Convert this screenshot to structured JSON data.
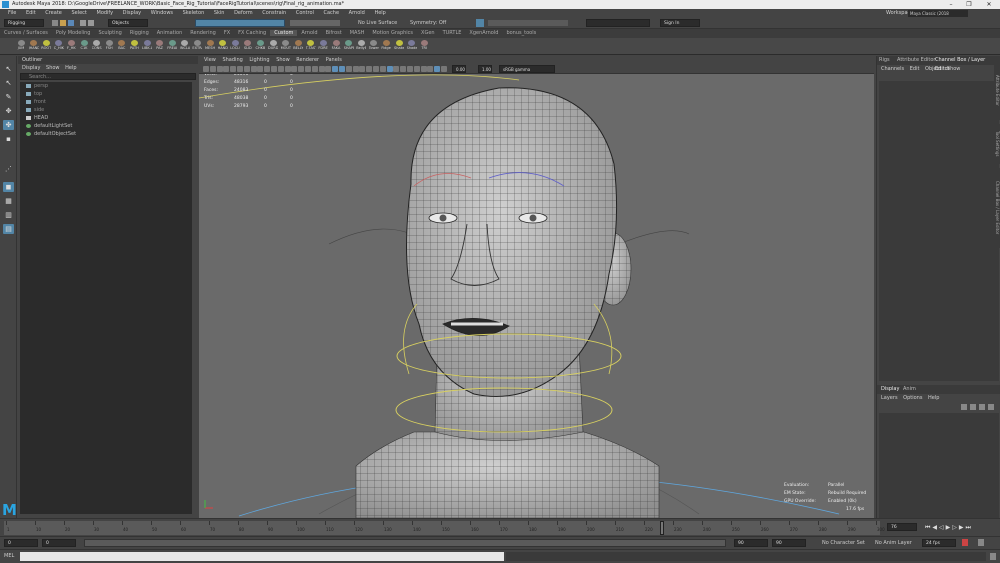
{
  "window": {
    "title": "Autodesk Maya 2018: D:\\GoogleDrive\\FREELANCE_WORK\\Basic_Face_Rig_Tutorial\\FaceRigTutorial\\scenes\\rig\\Final_rig_animation.ma*",
    "controls": [
      "–",
      "❐",
      "✕"
    ]
  },
  "menubar": [
    "File",
    "Edit",
    "Create",
    "Select",
    "Modify",
    "Display",
    "Windows",
    "Skeleton",
    "Skin",
    "Deform",
    "Constrain",
    "Control",
    "Cache",
    "Arnold",
    "Help"
  ],
  "workspace": {
    "label": "Workspace:",
    "value": "Maya Classic (2018 TUTORIAL)"
  },
  "statusline": {
    "mode": "Rigging",
    "objects": "Objects",
    "live_surface": "No Live Surface",
    "symmetry": "Symmetry: Off",
    "sign_in": "Sign In"
  },
  "shelf_tabs": [
    "Curves / Surfaces",
    "Poly Modeling",
    "Sculpting",
    "Rigging",
    "Animation",
    "Rendering",
    "FX",
    "FX Caching",
    "Custom",
    "Arnold",
    "Bifrost",
    "MASH",
    "Motion Graphics",
    "XGen",
    "TURTLE",
    "XgenArnold",
    "bonus_tools"
  ],
  "active_shelf_tab": 8,
  "shelf_buttons": [
    "JUM",
    "JHAND",
    "ROOT",
    "C_HIK",
    "F_HK",
    "C1K",
    "CONS",
    "FSH",
    "BAC",
    "PATH",
    "LIBK.LI",
    "PAZ",
    "FREAK",
    "INCLAB",
    "EXTRACT",
    "MESH",
    "HAND",
    "LOCLS",
    "SLID",
    "CHKB",
    "DURDAC",
    "MOUTH",
    "BELLY",
    "T.TASTE",
    "FDRET",
    "FAKA",
    "SHAPE",
    "BellyB",
    "Tower",
    "Fidget",
    "Shake",
    "Shader",
    "TRI"
  ],
  "outliner": {
    "title": "Outliner",
    "menu": [
      "Display",
      "Show",
      "Help"
    ],
    "search_placeholder": "Search...",
    "items": [
      "persp",
      "top",
      "front",
      "side",
      "HEAD",
      "defaultLightSet",
      "defaultObjectSet"
    ]
  },
  "viewport": {
    "menu": [
      "View",
      "Shading",
      "Lighting",
      "Show",
      "Renderer",
      "Panels"
    ],
    "gamma": "sRGB gamma",
    "exposure": "0.00",
    "gamma_value": "1.00",
    "hud_stats": [
      {
        "label": "Verts:",
        "v1": "24091",
        "v2": "0",
        "v3": "0"
      },
      {
        "label": "Edges:",
        "v1": "48316",
        "v2": "0",
        "v3": "0"
      },
      {
        "label": "Faces:",
        "v1": "24083",
        "v2": "0",
        "v3": "0"
      },
      {
        "label": "Tris:",
        "v1": "48038",
        "v2": "0",
        "v3": "0"
      },
      {
        "label": "UVs:",
        "v1": "28793",
        "v2": "0",
        "v3": "0"
      }
    ],
    "hud_eval": [
      {
        "label": "Evaluation:",
        "value": "Parallel"
      },
      {
        "label": "EM State:",
        "value": "Rebuild Required"
      },
      {
        "label": "GPU Override:",
        "value": "Enabled (0k)"
      }
    ],
    "fps": "17.6 fps"
  },
  "right_panel": {
    "tabs": [
      "Rigs",
      "Attribute Editor",
      "Channel Box / Layer Editor"
    ],
    "menu": [
      "Channels",
      "Edit",
      "Object",
      "Show"
    ],
    "lower_tabs": [
      "Display",
      "Anim"
    ],
    "lower_menu": [
      "Layers",
      "Options",
      "Help"
    ],
    "side_tabs": [
      "Attribute Editor",
      "Tool Settings",
      "Channel Box / Layer Editor"
    ]
  },
  "timeline": {
    "ticks": [
      "1",
      "10",
      "20",
      "30",
      "40",
      "50",
      "60",
      "70",
      "80",
      "90",
      "100",
      "110",
      "120",
      "130",
      "140",
      "150",
      "160",
      "170",
      "180",
      "190",
      "200",
      "210",
      "220",
      "230",
      "240",
      "250",
      "260",
      "270",
      "280",
      "290",
      "300"
    ],
    "current_frame": "76"
  },
  "range": {
    "start": "0",
    "playback_start": "0",
    "playback_end": "90",
    "end": "90",
    "character_set": "No Character Set",
    "anim_layer": "No Anim Layer",
    "fps": "24 fps"
  },
  "cmdline": {
    "label": "MEL"
  },
  "colors": {
    "accent": "#5285a6",
    "maya_logo": "#2aa4e0",
    "viewport_bg": "#6a6a6a",
    "hud_orange": "#e8a020",
    "hud_blue": "#5fa8e0"
  }
}
